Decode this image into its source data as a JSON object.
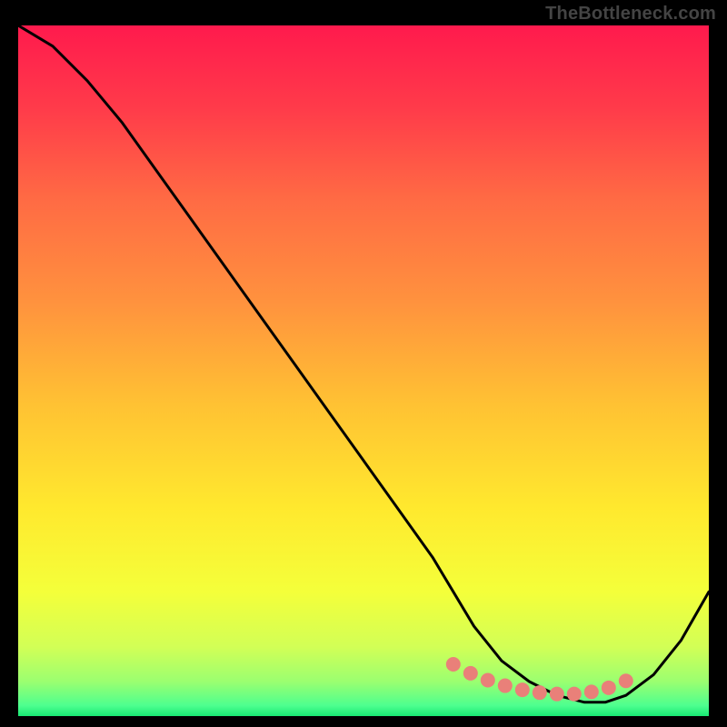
{
  "watermark": "TheBottleneck.com",
  "chart_data": {
    "type": "line",
    "title": "",
    "xlabel": "",
    "ylabel": "",
    "xlim": [
      0,
      100
    ],
    "ylim": [
      0,
      100
    ],
    "series": [
      {
        "name": "curve",
        "x": [
          0,
          5,
          10,
          15,
          20,
          25,
          30,
          35,
          40,
          45,
          50,
          55,
          60,
          63,
          66,
          70,
          74,
          78,
          82,
          85,
          88,
          92,
          96,
          100
        ],
        "y": [
          100,
          97,
          92,
          86,
          79,
          72,
          65,
          58,
          51,
          44,
          37,
          30,
          23,
          18,
          13,
          8,
          5,
          3,
          2,
          2,
          3,
          6,
          11,
          18
        ]
      }
    ],
    "markers": {
      "name": "dots",
      "x": [
        63,
        65.5,
        68,
        70.5,
        73,
        75.5,
        78,
        80.5,
        83,
        85.5,
        88
      ],
      "y": [
        7.5,
        6.2,
        5.2,
        4.4,
        3.8,
        3.4,
        3.2,
        3.2,
        3.5,
        4.1,
        5.1
      ]
    },
    "gradient_stops": [
      {
        "offset": 0.0,
        "color": "#ff1a4d"
      },
      {
        "offset": 0.12,
        "color": "#ff3b4a"
      },
      {
        "offset": 0.25,
        "color": "#ff6a44"
      },
      {
        "offset": 0.4,
        "color": "#ff923e"
      },
      {
        "offset": 0.55,
        "color": "#ffc233"
      },
      {
        "offset": 0.7,
        "color": "#ffe92e"
      },
      {
        "offset": 0.82,
        "color": "#f4ff3a"
      },
      {
        "offset": 0.9,
        "color": "#d2ff56"
      },
      {
        "offset": 0.95,
        "color": "#9bff70"
      },
      {
        "offset": 0.985,
        "color": "#4dff8f"
      },
      {
        "offset": 1.0,
        "color": "#18e873"
      }
    ],
    "marker_color": "#e98079",
    "curve_color": "#000000"
  }
}
